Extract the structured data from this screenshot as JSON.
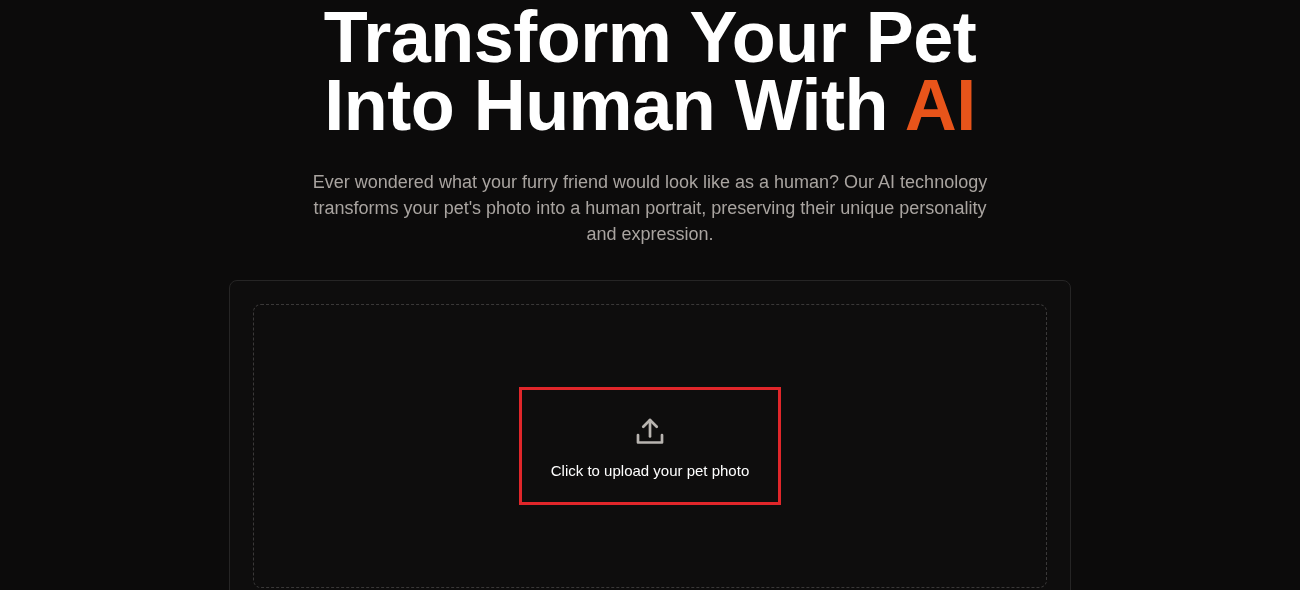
{
  "hero": {
    "title_lines": [
      "Transform Your Pet",
      "Into Human With"
    ],
    "title_highlight": "AI",
    "subtitle": "Ever wondered what your furry friend would look like as a human? Our AI technology transforms your pet's photo into a human portrait, preserving their unique personality and expression."
  },
  "upload": {
    "label": "Click to upload your pet photo",
    "highlighted": true
  }
}
